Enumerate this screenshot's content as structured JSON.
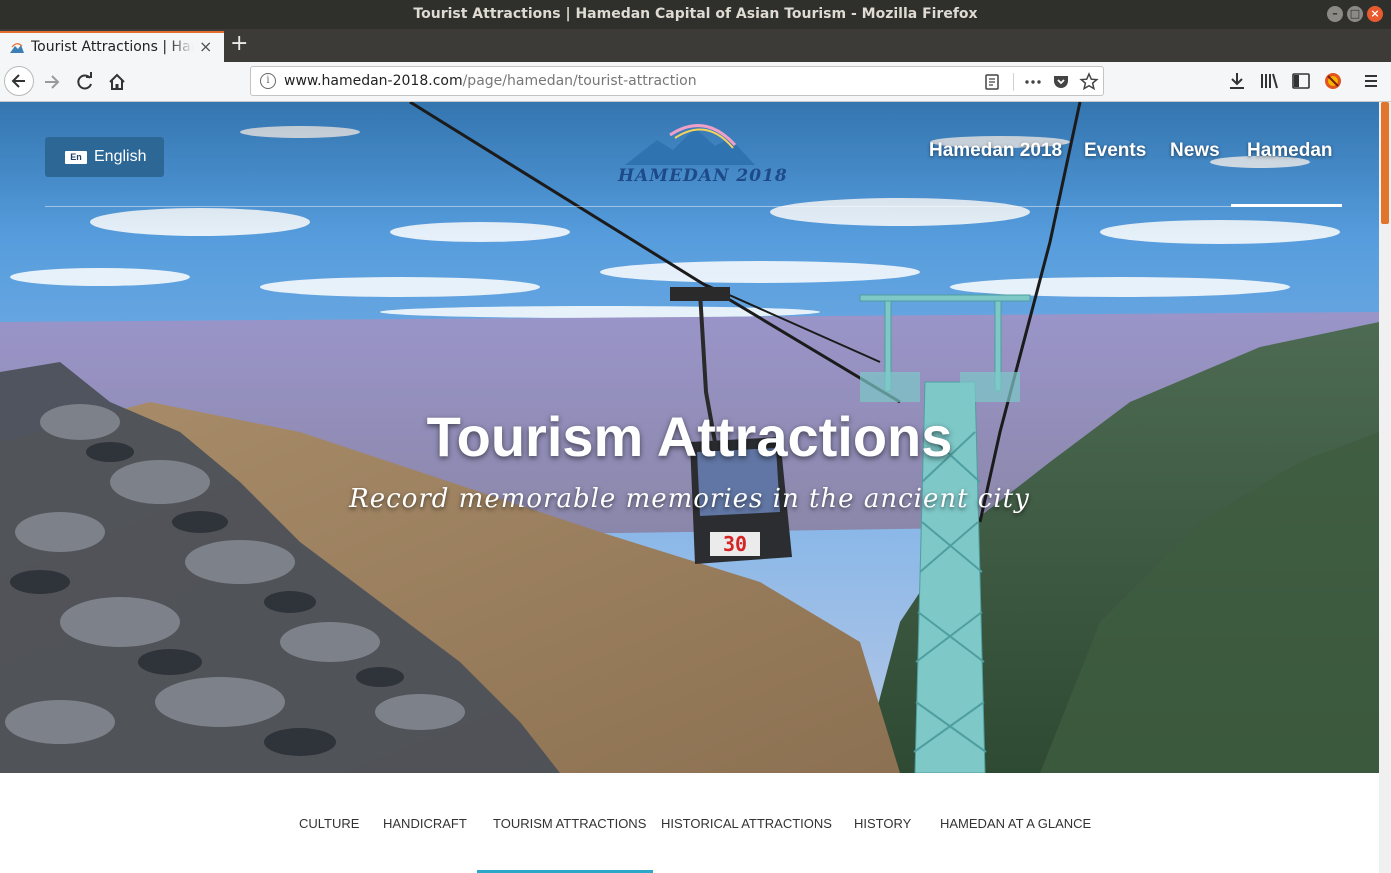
{
  "window": {
    "title": "Tourist Attractions | Hamedan Capital of Asian Tourism - Mozilla Firefox",
    "buttons": [
      "–",
      "□",
      "×"
    ]
  },
  "tabs": [
    {
      "label": "Tourist Attractions | Hamedan Capital of Asian Tourism",
      "close": "×",
      "active": true
    }
  ],
  "new_tab": "+",
  "url": {
    "host": "www.hamedan-2018.com",
    "path": "/page/hamedan/tourist-attraction"
  },
  "icons": {
    "back": "back-arrow-icon",
    "forward": "forward-arrow-icon",
    "reload": "reload-icon",
    "home": "home-icon",
    "site_info": "info-icon",
    "reader": "reader-view-icon",
    "page_actions": "more-actions-icon",
    "pocket": "pocket-icon",
    "bookmark": "star-icon",
    "downloads": "download-icon",
    "library": "library-icon",
    "sidebar": "sidebar-icon",
    "addon": "addon-icon",
    "menu": "hamburger-menu-icon"
  },
  "site": {
    "language_button": {
      "badge": "En",
      "label": "English"
    },
    "logo_text": "HAMEDAN 2018",
    "nav": [
      "Hamedan 2018",
      "Events",
      "News",
      "Hamedan"
    ],
    "active_nav": "Hamedan",
    "hero": {
      "title": "Tourism Attractions",
      "subtitle": "Record memorable memories in the ancient city",
      "cabin_number": "30"
    },
    "subnav": [
      "CULTURE",
      "HANDICRAFT",
      "TOURISM ATTRACTIONS",
      "HISTORICAL ATTRACTIONS",
      "HISTORY",
      "HAMEDAN AT A GLANCE"
    ],
    "active_subnav": "TOURISM ATTRACTIONS"
  },
  "colors": {
    "brand_blue": "#2d6796",
    "accent_teal": "#2ba7c9",
    "firefox_tab_accent": "#e46d30",
    "scroll_thumb": "#e0752b"
  }
}
